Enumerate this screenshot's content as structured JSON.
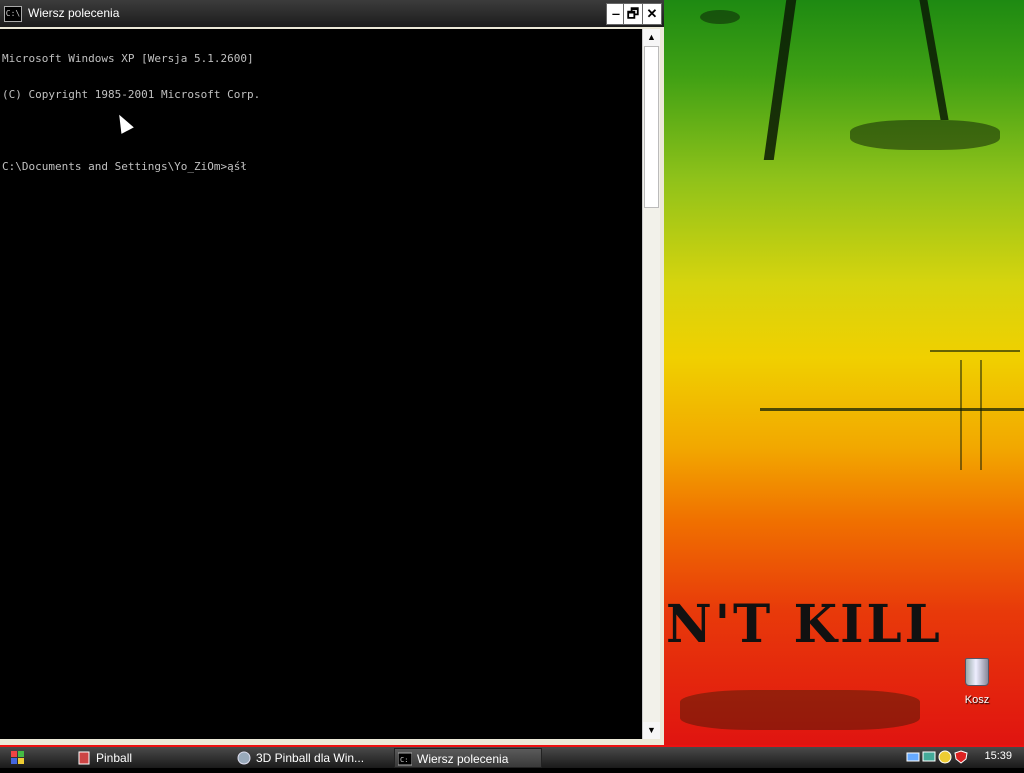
{
  "window": {
    "title": "Wiersz polecenia",
    "icon": "cmd-icon",
    "icon_text": "C:\\",
    "buttons": {
      "minimize": "‒",
      "restore": "🗗",
      "close": "✕"
    }
  },
  "console": {
    "lines": [
      "Microsoft Windows XP [Wersja 5.1.2600]",
      "(C) Copyright 1985-2001 Microsoft Corp.",
      "",
      "C:\\Documents and Settings\\Yo_ZiOm>ąśł"
    ]
  },
  "scrollbar": {
    "up": "▲",
    "down": "▼"
  },
  "desktop": {
    "wallpaper_text": "N'T KILL",
    "recycle_bin_label": "Kosz"
  },
  "taskbar": {
    "items": [
      {
        "label": "Pinball",
        "icon": "pinball-icon"
      },
      {
        "label": "3D Pinball dla Win...",
        "icon": "media-player-icon"
      },
      {
        "label": "Wiersz polecenia",
        "icon": "cmd-icon",
        "active": true
      }
    ],
    "clock": "15:39",
    "tray_icons": [
      "network-icon",
      "computer-icon",
      "update-icon",
      "security-shield-icon"
    ]
  },
  "colors": {
    "console_text": "#c0c0c0",
    "accent_red": "#ee1111"
  }
}
